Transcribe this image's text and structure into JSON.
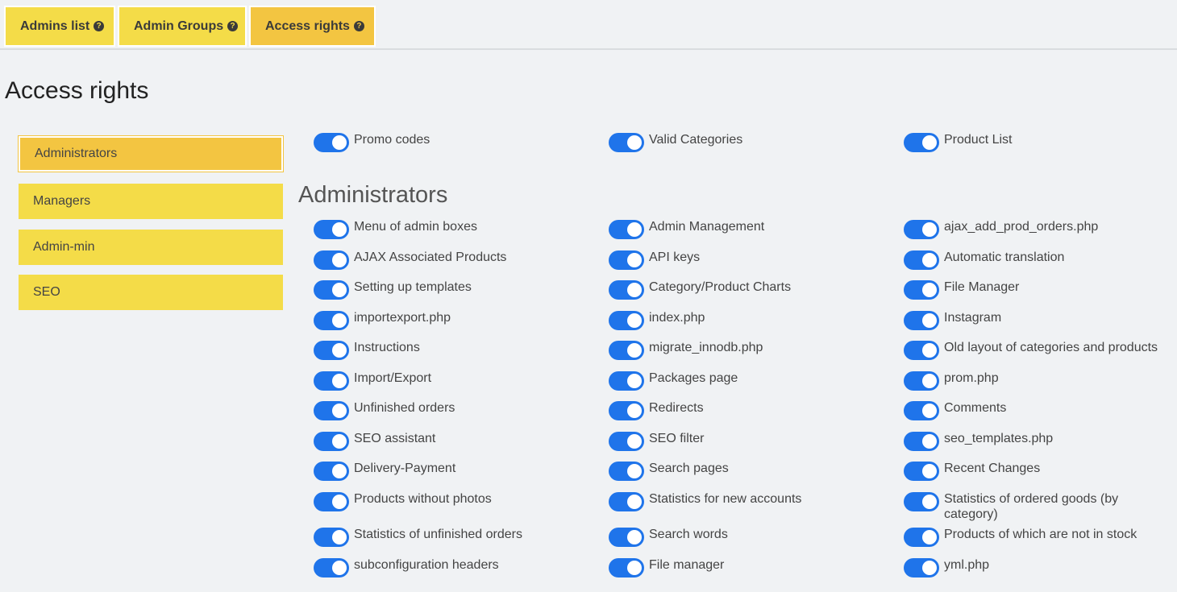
{
  "tabs": [
    {
      "label": "Admins list",
      "icon": "question-circle-icon",
      "active": false
    },
    {
      "label": "Admin Groups",
      "icon": "question-circle-icon",
      "active": false
    },
    {
      "label": "Access rights",
      "icon": "question-circle-icon",
      "active": true
    }
  ],
  "page_title": "Access rights",
  "groups": [
    {
      "label": "Administrators",
      "active": true
    },
    {
      "label": "Managers",
      "active": false
    },
    {
      "label": "Admin-min",
      "active": false
    },
    {
      "label": "SEO",
      "active": false
    }
  ],
  "top_permissions": [
    {
      "label": "Promo codes",
      "enabled": true
    },
    {
      "label": "Valid Categories",
      "enabled": true
    },
    {
      "label": "Product List",
      "enabled": true
    }
  ],
  "section_title": "Administrators",
  "permissions": [
    {
      "label": "Menu of admin boxes",
      "enabled": true
    },
    {
      "label": "Admin Management",
      "enabled": true
    },
    {
      "label": "ajax_add_prod_orders.php",
      "enabled": true
    },
    {
      "label": "AJAX Associated Products",
      "enabled": true
    },
    {
      "label": "API keys",
      "enabled": true
    },
    {
      "label": "Automatic translation",
      "enabled": true
    },
    {
      "label": "Setting up templates",
      "enabled": true
    },
    {
      "label": "Category/Product Charts",
      "enabled": true
    },
    {
      "label": "File Manager",
      "enabled": true
    },
    {
      "label": "importexport.php",
      "enabled": true
    },
    {
      "label": "index.php",
      "enabled": true
    },
    {
      "label": "Instagram",
      "enabled": true
    },
    {
      "label": "Instructions",
      "enabled": true
    },
    {
      "label": "migrate_innodb.php",
      "enabled": true
    },
    {
      "label": "Old layout of categories and products",
      "enabled": true
    },
    {
      "label": "Import/Export",
      "enabled": true
    },
    {
      "label": "Packages page",
      "enabled": true
    },
    {
      "label": "prom.php",
      "enabled": true
    },
    {
      "label": "Unfinished orders",
      "enabled": true
    },
    {
      "label": "Redirects",
      "enabled": true
    },
    {
      "label": "Comments",
      "enabled": true
    },
    {
      "label": "SEO assistant",
      "enabled": true
    },
    {
      "label": "SEO filter",
      "enabled": true
    },
    {
      "label": "seo_templates.php",
      "enabled": true
    },
    {
      "label": "Delivery-Payment",
      "enabled": true
    },
    {
      "label": "Search pages",
      "enabled": true
    },
    {
      "label": "Recent Changes",
      "enabled": true
    },
    {
      "label": "Products without photos",
      "enabled": true
    },
    {
      "label": "Statistics for new accounts",
      "enabled": true
    },
    {
      "label": "Statistics of ordered goods (by category)",
      "enabled": true
    },
    {
      "label": "Statistics of unfinished orders",
      "enabled": true
    },
    {
      "label": "Search words",
      "enabled": true
    },
    {
      "label": "Products of which are not in stock",
      "enabled": true
    },
    {
      "label": "subconfiguration headers",
      "enabled": true
    },
    {
      "label": "File manager",
      "enabled": true
    },
    {
      "label": "yml.php",
      "enabled": true
    }
  ],
  "colors": {
    "tab_bg": "#f4dc48",
    "tab_active_bg": "#f3c541",
    "toggle_on": "#1f74ea",
    "page_bg": "#f0f2f4"
  }
}
